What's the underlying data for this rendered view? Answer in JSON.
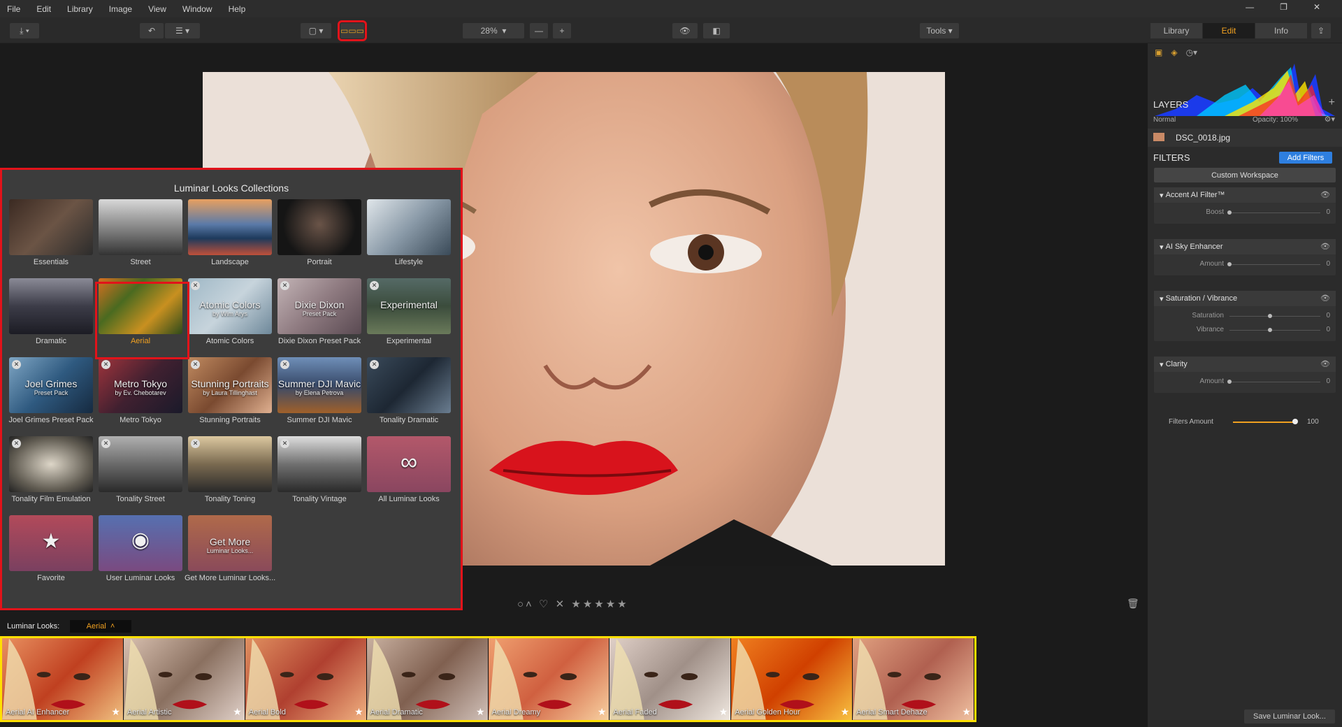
{
  "menu": [
    "File",
    "Edit",
    "Library",
    "Image",
    "View",
    "Window",
    "Help"
  ],
  "toolbar": {
    "zoom": "28%",
    "tools_label": "Tools"
  },
  "right_tabs": [
    "Library",
    "Edit",
    "Info"
  ],
  "collections": {
    "title": "Luminar Looks Collections",
    "items": [
      {
        "label": "Essentials"
      },
      {
        "label": "Street"
      },
      {
        "label": "Landscape"
      },
      {
        "label": "Portrait"
      },
      {
        "label": "Lifestyle"
      },
      {
        "label": "Dramatic"
      },
      {
        "label": "Aerial",
        "selected": true
      },
      {
        "label": "Atomic Colors",
        "overlay": "Atomic Colors",
        "sub": "by Wim Arys"
      },
      {
        "label": "Dixie Dixon Preset Pack",
        "overlay": "Dixie Dixon",
        "sub": "Preset Pack"
      },
      {
        "label": "Experimental",
        "overlay": "Experimental"
      },
      {
        "label": "Joel Grimes Preset Pack",
        "overlay": "Joel Grimes",
        "sub": "Preset Pack"
      },
      {
        "label": "Metro Tokyo",
        "overlay": "Metro Tokyo",
        "sub": "by Ev. Chebotarev"
      },
      {
        "label": "Stunning Portraits",
        "overlay": "Stunning Portraits",
        "sub": "by Laura Tillinghast"
      },
      {
        "label": "Summer DJI Mavic",
        "overlay": "Summer DJI Mavic",
        "sub": "by Elena Petrova"
      },
      {
        "label": "Tonality Dramatic"
      },
      {
        "label": "Tonality Film Emulation"
      },
      {
        "label": "Tonality Street"
      },
      {
        "label": "Tonality Toning"
      },
      {
        "label": "Tonality Vintage"
      },
      {
        "label": "All Luminar Looks"
      },
      {
        "label": "Favorite"
      },
      {
        "label": "User Luminar Looks"
      },
      {
        "label": "Get More Luminar Looks...",
        "overlay": "Get More",
        "sub": "Luminar Looks..."
      }
    ]
  },
  "looks_bar": {
    "label": "Luminar Looks:",
    "selected": "Aerial"
  },
  "thumbnails": [
    "Aerial AI Enhancer",
    "Aerial Artistic",
    "Aerial Bold",
    "Aerial Dramatic",
    "Aerial Dreamy",
    "Aerial Faded",
    "Aerial Golden Hour",
    "Aerial Smart Dehaze"
  ],
  "panel": {
    "layers_title": "LAYERS",
    "blend_mode": "Normal",
    "opacity": "Opacity: 100%",
    "layer_name": "DSC_0018.jpg",
    "filters_title": "FILTERS",
    "add_filters": "Add Filters",
    "workspace": "Custom Workspace",
    "filters": [
      {
        "name": "Accent AI Filter™",
        "rows": [
          {
            "label": "Boost",
            "value": "0"
          }
        ]
      },
      {
        "name": "AI Sky Enhancer",
        "rows": [
          {
            "label": "Amount",
            "value": "0"
          }
        ]
      },
      {
        "name": "Saturation / Vibrance",
        "rows": [
          {
            "label": "Saturation",
            "value": "0"
          },
          {
            "label": "Vibrance",
            "value": "0"
          }
        ]
      },
      {
        "name": "Clarity",
        "rows": [
          {
            "label": "Amount",
            "value": "0"
          }
        ]
      }
    ],
    "filters_amount_label": "Filters Amount",
    "filters_amount": "100"
  },
  "save_look": "Save Luminar Look..."
}
